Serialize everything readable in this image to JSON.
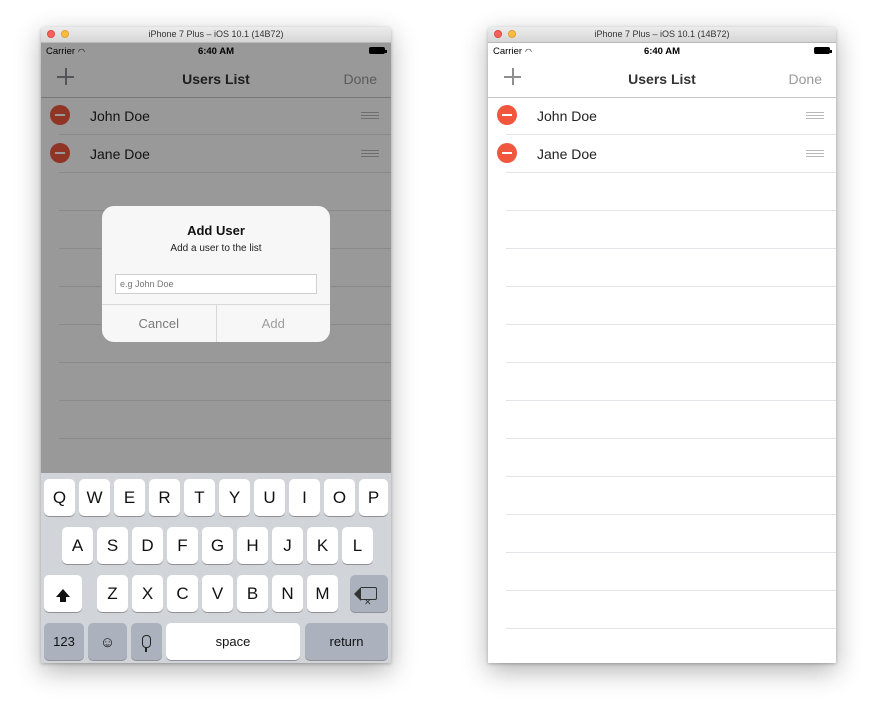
{
  "device_title": "iPhone 7 Plus – iOS 10.1 (14B72)",
  "statusbar": {
    "carrier": "Carrier",
    "time": "6:40 AM"
  },
  "navbar": {
    "title": "Users List",
    "done_label": "Done"
  },
  "users": [
    "John Doe",
    "Jane Doe"
  ],
  "alert": {
    "title": "Add User",
    "message": "Add a user to the list",
    "placeholder": "e.g John Doe",
    "cancel_label": "Cancel",
    "add_label": "Add"
  },
  "keyboard": {
    "row1": [
      "Q",
      "W",
      "E",
      "R",
      "T",
      "Y",
      "U",
      "I",
      "O",
      "P"
    ],
    "row2": [
      "A",
      "S",
      "D",
      "F",
      "G",
      "H",
      "J",
      "K",
      "L"
    ],
    "row3": [
      "Z",
      "X",
      "C",
      "V",
      "B",
      "N",
      "M"
    ],
    "numbers_label": "123",
    "space_label": "space",
    "return_label": "return"
  },
  "colors": {
    "delete": "#f1573e",
    "keyboard_bg": "#d1d4d9",
    "dim_overlay": "rgba(0,0,0,0.40)"
  }
}
